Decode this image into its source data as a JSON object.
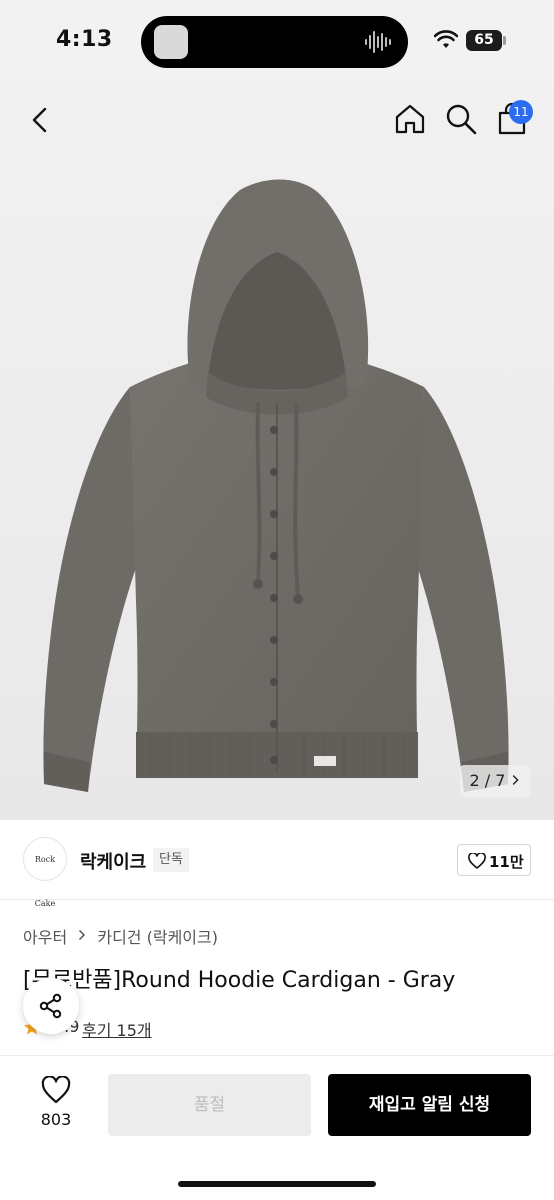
{
  "status_bar": {
    "time": "4:13",
    "battery": "65"
  },
  "nav": {
    "cart_badge": "11"
  },
  "gallery": {
    "counter": "2 / 7"
  },
  "brand": {
    "logo_text": "Rock Cake",
    "name": "락케이크",
    "badge": "단독",
    "likes": "11만"
  },
  "product": {
    "breadcrumb": [
      "아우터",
      "카디건 (락케이크)"
    ],
    "title": "[무료반품]Round Hoodie Cardigan - Gray",
    "rating": "4.9",
    "reviews": "후기 15개"
  },
  "bottom_bar": {
    "wish_count": "803",
    "soldout_label": "품절",
    "restock_label": "재입고 알림 신청"
  },
  "colors": {
    "accent_badge": "#2b6cf0",
    "garment": "#6f6b67",
    "primary_button": "#000000"
  }
}
